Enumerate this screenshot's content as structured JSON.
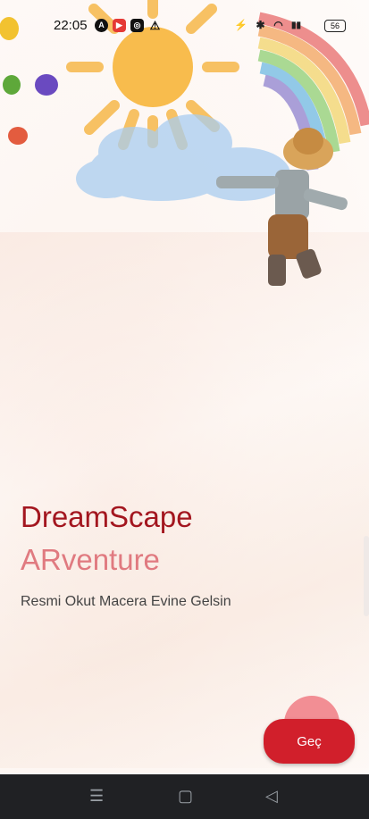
{
  "status_bar": {
    "time": "22:05",
    "battery": "56",
    "icons": [
      "a-icon",
      "video-icon",
      "instagram-icon",
      "warning-icon",
      "vibrate-icon",
      "bluetooth-icon",
      "wifi-icon",
      "signal-icon"
    ]
  },
  "main": {
    "title_line1": "DreamScape",
    "title_line2": "ARventure",
    "subtitle": "Resmi Okut Macera Evine Gelsin",
    "next_button": "Geç"
  },
  "colors": {
    "title_primary": "#a3161f",
    "title_secondary": "#e07a80",
    "button": "#d11f2b"
  },
  "nav_bar": {
    "icons": [
      "menu-icon",
      "home-icon",
      "back-icon"
    ]
  }
}
